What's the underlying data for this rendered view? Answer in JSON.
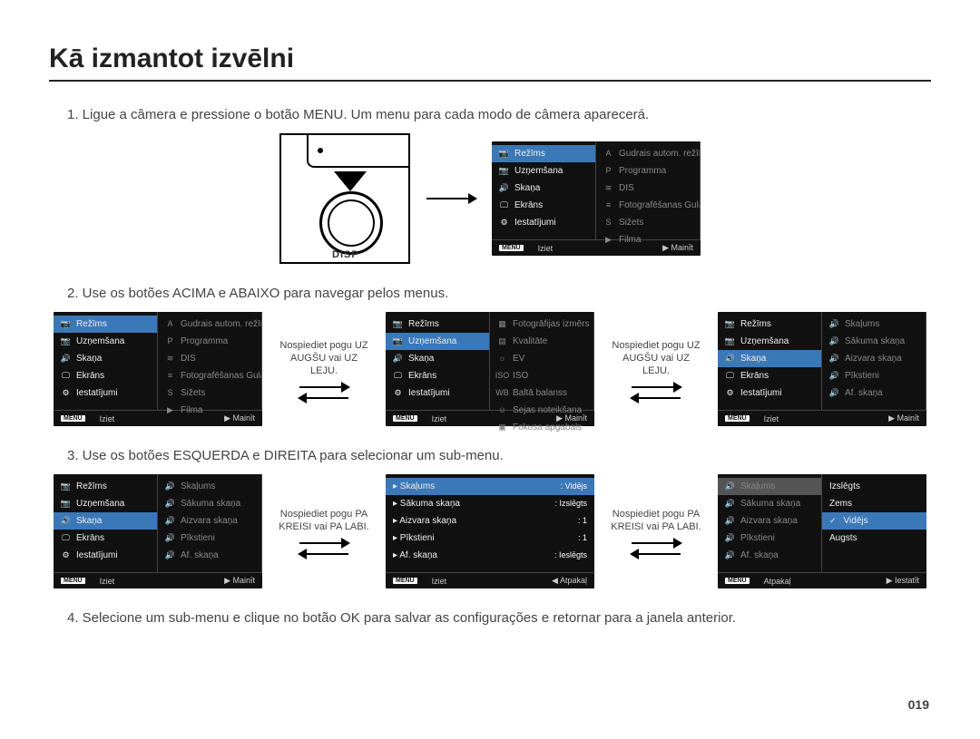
{
  "title": "Kā izmantot izvēlni",
  "page_number": "019",
  "steps": [
    "1. Ligue a câmera e pressione o botão MENU. Um menu para cada modo de câmera aparecerá.",
    "2. Use os botões ACIMA e ABAIXO para navegar pelos menus.",
    "3. Use os botões ESQUERDA e DIREITA para selecionar um sub-menu.",
    "4. Selecione um sub-menu e clique no botão OK para salvar as configurações e retornar para a janela anterior."
  ],
  "camera": {
    "disp": "DISP"
  },
  "captions": {
    "updown": "Nospiediet pogu UZ AUGŠU vai UZ LEJU.",
    "leftright": "Nospiediet pogu PA KREISI vai PA LABI."
  },
  "footer": {
    "menu": "MENU",
    "iziet": "Iziet",
    "mainit": "Mainīt",
    "atpakal": "Atpakaļ",
    "iestatit": "Iestatīt"
  },
  "leftMenu": {
    "items": [
      "Režīms",
      "Uzņemšana",
      "Skaņa",
      "Ekrāns",
      "Iestatījumi"
    ],
    "icons": [
      "📷",
      "📷",
      "🔊",
      "🖵",
      "⚙"
    ]
  },
  "subMode": {
    "items": [
      "Gudrais autom. režīms",
      "Programma",
      "DIS",
      "Fotografēšanas Gulām",
      "Sižets",
      "Filma"
    ],
    "icons": [
      "A",
      "P",
      "≋",
      "≡",
      "S",
      "▶"
    ]
  },
  "subShoot": {
    "items": [
      "Fotogrāfijas izmērs",
      "Kvalitāte",
      "EV",
      "ISO",
      "Baltā balanss",
      "Sejas noteikšana",
      "Fokusa apgabals"
    ],
    "icons": [
      "▦",
      "▤",
      "☼",
      "ISO",
      "WB",
      "☺",
      "▣"
    ]
  },
  "subSound": {
    "items": [
      "Skaļums",
      "Sākuma skaņa",
      "Aizvara skaņa",
      "Pīkstieni",
      "Af. skaņa"
    ],
    "icons": [
      "🔊",
      "🔊",
      "🔊",
      "🔊",
      "🔊"
    ]
  },
  "subVolume": {
    "items": [
      "Skaļums",
      "Sākuma skaņa",
      "Aizvara skaņa",
      "Pīkstieni",
      "Af. skaņa"
    ],
    "values": [
      "Vidējs",
      "Izslēgts",
      "1",
      "1",
      "Ieslēgts"
    ]
  },
  "subLevels": {
    "items": [
      "Izslēgts",
      "Zems",
      "Vidējs",
      "Augsts"
    ]
  }
}
